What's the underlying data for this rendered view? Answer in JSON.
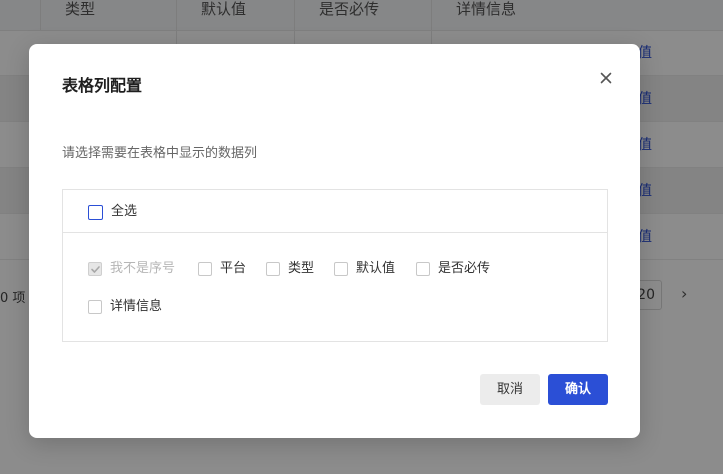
{
  "background": {
    "table_headers": [
      "类型",
      "默认值",
      "是否必传",
      "详情信息"
    ],
    "row_link_text": "值",
    "pager_total_text": "0 项",
    "pager_size": "20",
    "pager_next_icon": "chevron-right-icon"
  },
  "modal": {
    "title": "表格列配置",
    "close_icon": "close-icon",
    "description": "请选择需要在表格中显示的数据列",
    "select_all": {
      "label": "全选",
      "checked": false
    },
    "columns": [
      {
        "label": "我不是序号",
        "checked": true,
        "disabled": true
      },
      {
        "label": "平台",
        "checked": false,
        "disabled": false
      },
      {
        "label": "类型",
        "checked": false,
        "disabled": false
      },
      {
        "label": "默认值",
        "checked": false,
        "disabled": false
      },
      {
        "label": "是否必传",
        "checked": false,
        "disabled": false
      },
      {
        "label": "详情信息",
        "checked": false,
        "disabled": false
      }
    ],
    "buttons": {
      "cancel": "取消",
      "confirm": "确认"
    }
  },
  "colors": {
    "primary": "#2b4fd6",
    "overlay": "rgba(0,0,0,0.45)",
    "cancel_bg": "#ececec"
  }
}
